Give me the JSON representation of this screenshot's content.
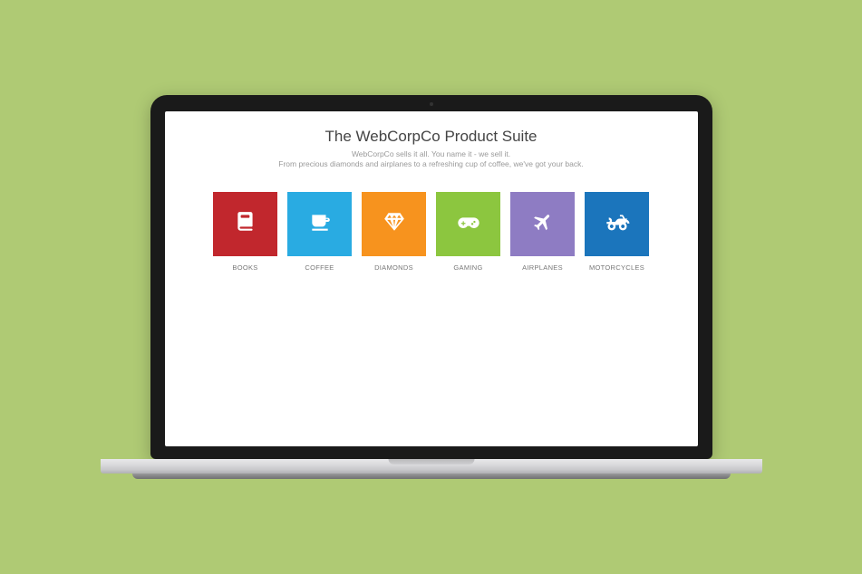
{
  "header": {
    "title": "The WebCorpCo Product Suite",
    "subtitle1": "WebCorpCo sells it all. You name it - we sell it.",
    "subtitle2": "From precious diamonds and airplanes to a refreshing cup of coffee, we've got your back."
  },
  "tiles": [
    {
      "label": "BOOKS",
      "icon": "book-icon",
      "color": "#c1272d"
    },
    {
      "label": "COFFEE",
      "icon": "coffee-icon",
      "color": "#29abe2"
    },
    {
      "label": "DIAMONDS",
      "icon": "diamond-icon",
      "color": "#f7931e"
    },
    {
      "label": "GAMING",
      "icon": "gamepad-icon",
      "color": "#8cc63f"
    },
    {
      "label": "AIRPLANES",
      "icon": "airplane-icon",
      "color": "#8e7cc3"
    },
    {
      "label": "MOTORCYCLES",
      "icon": "motorcycle-icon",
      "color": "#1b75bc"
    }
  ]
}
